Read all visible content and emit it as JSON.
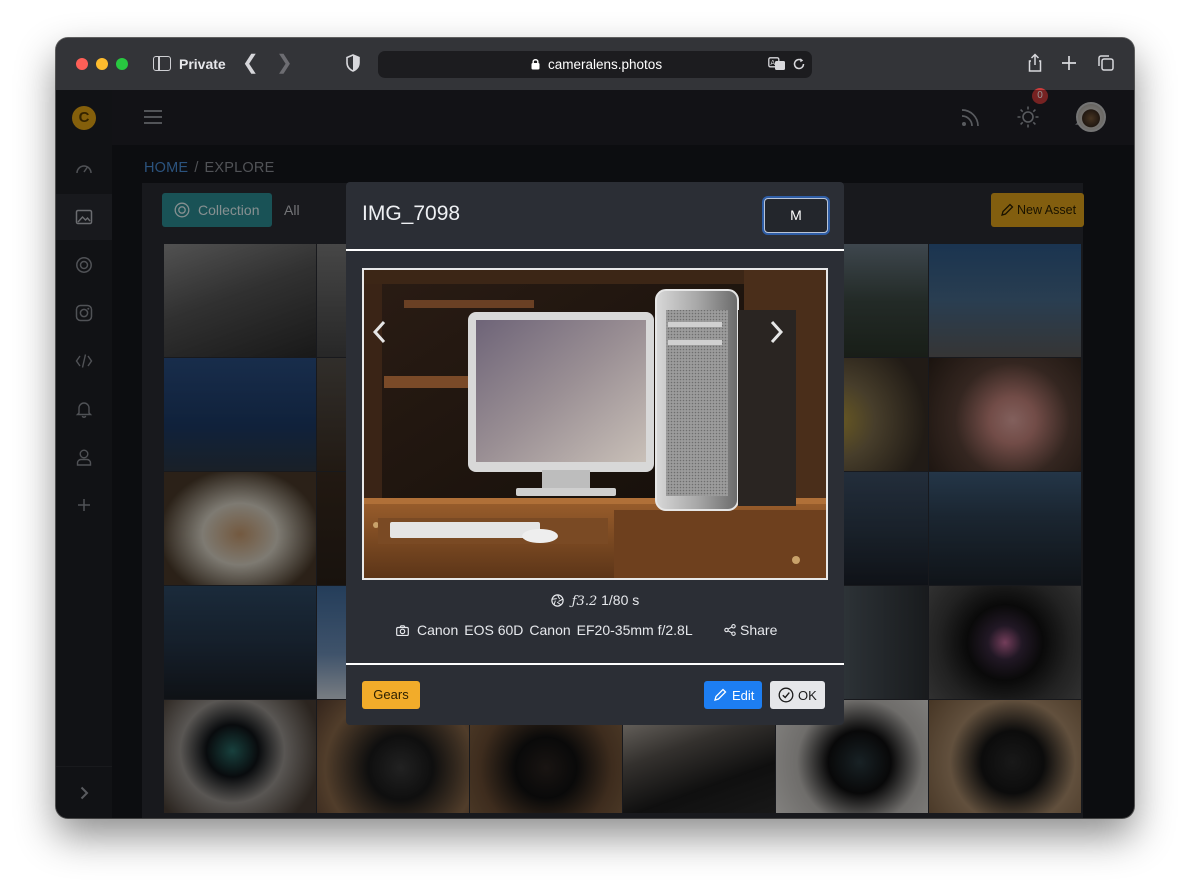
{
  "browser": {
    "mode_label": "Private",
    "url": "cameralens.photos"
  },
  "app": {
    "logo_letter": "C",
    "notifications_count": "0",
    "sidebar_icons": [
      "dashboard-icon",
      "gallery-icon",
      "lens-icon",
      "instagram-icon",
      "code-icon",
      "bell-icon",
      "user-icon",
      "plus-icon"
    ],
    "header_icons": [
      "rss-icon",
      "sun-icon",
      "bell-icon"
    ]
  },
  "breadcrumb": {
    "home": "HOME",
    "separator": "/",
    "current": "EXPLORE"
  },
  "toolbar": {
    "collection_tab": "Collection",
    "all_tab": "All",
    "new_asset": "New Asset"
  },
  "modal": {
    "title": "IMG_7098",
    "size_button": "M",
    "exposure": {
      "aperture": "ƒ3.2",
      "shutter": "1/80 s"
    },
    "gear": {
      "camera_make": "Canon",
      "camera_model": "EOS 60D",
      "lens_make": "Canon",
      "lens_model": "EF20-35mm f/2.8L"
    },
    "share_label": "Share",
    "gears_button": "Gears",
    "edit_button": "Edit",
    "ok_button": "OK"
  },
  "colors": {
    "accent_teal": "#2c8d95",
    "accent_yellow": "#e0a31a",
    "primary_blue": "#1d7ef2",
    "link_blue": "#4a8fd9",
    "badge_red": "#cc3b3b"
  }
}
